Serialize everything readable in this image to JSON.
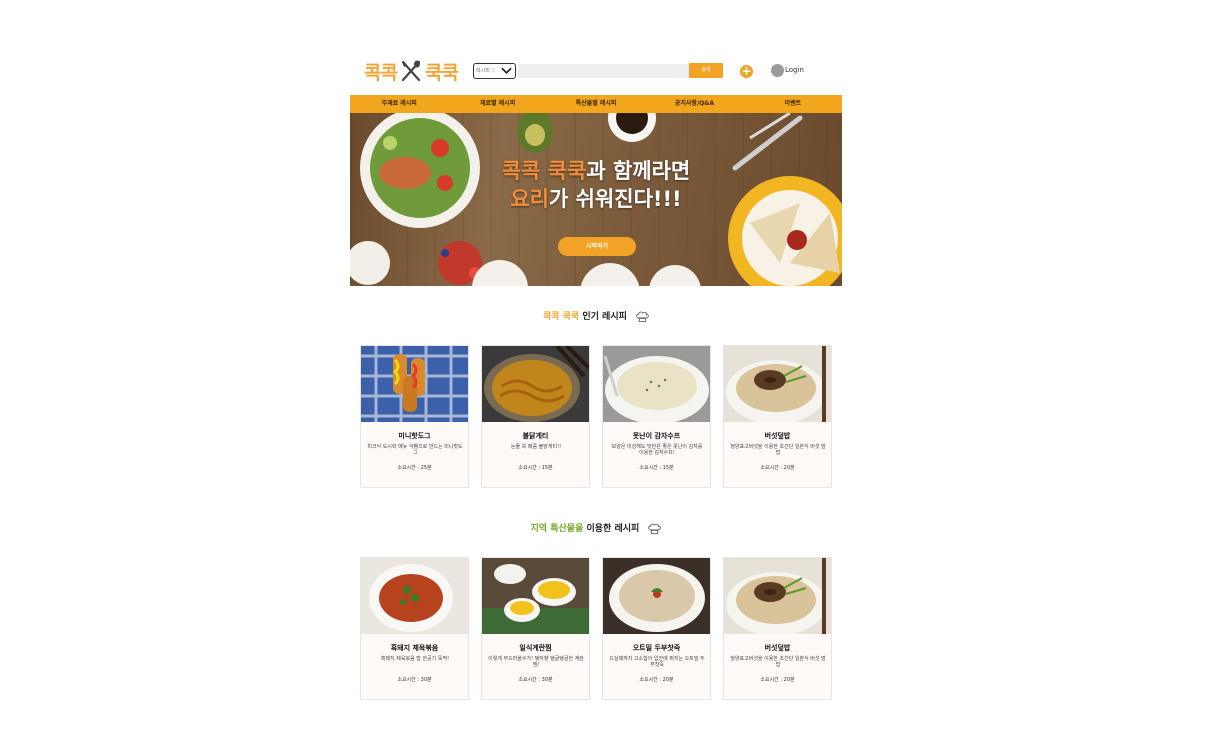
{
  "header": {
    "logo_left": "콕콕",
    "logo_right": "쿡쿡",
    "search_select": "레시피 ▽",
    "search_button": "검색",
    "login": "Login"
  },
  "nav": [
    "주재료 레시피",
    "재료별 레시피",
    "특산물별 레시피",
    "공지사항/Q&A",
    "이벤트"
  ],
  "hero": {
    "line1_accent": "콕콕 쿡쿡",
    "line1_rest": "과 함께라면",
    "line2_accent": "요리",
    "line2_rest": "가 쉬워진다!!!",
    "cta": "시작하기"
  },
  "popular": {
    "title_accent": "콕콕 쿡쿡",
    "title_rest": "인기 레시피",
    "cards": [
      {
        "name": "미니핫도그",
        "desc": "피크닉 도시락 메뉴 식빵으로 만드는 미니핫도그",
        "time": "소요시간 : 25분",
        "thumb": "hotdog"
      },
      {
        "name": "불닭게티",
        "desc": "눈물 쏙 매콤 불닭게티!!",
        "time": "소요시간 : 15분",
        "thumb": "noodle"
      },
      {
        "name": "못난이 감자수프",
        "desc": "모양은 미성해도 맛만은 좋은 못난이 감자를 이용한 감자수프!",
        "time": "소요시간 : 15분",
        "thumb": "soup"
      },
      {
        "name": "버섯덮밥",
        "desc": "청양표고버섯을 이용한 초간단 일본식 버섯 덮밥",
        "time": "소요시간 : 20분",
        "thumb": "mushroom"
      }
    ]
  },
  "local": {
    "title_accent": "지역 특산물을",
    "title_rest": "이용한 레시피",
    "cards": [
      {
        "name": "흑돼지 제육볶음",
        "desc": "흑돼지 제육볶음 밥 한공기 뚝딱!",
        "time": "소요시간 : 30분",
        "thumb": "pork"
      },
      {
        "name": "일식계란찜",
        "desc": "이렇게 부드러울수가! 탱자향 탱글탱글한 계란찜!",
        "time": "소요시간 : 30분",
        "thumb": "egg"
      },
      {
        "name": "오트밀 두부찻죽",
        "desc": "드실때까지 고소함이 입안에 퍼지는 오트밀 두부찻죽",
        "time": "소요시간 : 20분",
        "thumb": "porridge"
      },
      {
        "name": "버섯덮밥",
        "desc": "청양표고버섯을 이용한 초간단 일본식 버섯 덮밥",
        "time": "소요시간 : 20분",
        "thumb": "mushroom"
      }
    ]
  }
}
